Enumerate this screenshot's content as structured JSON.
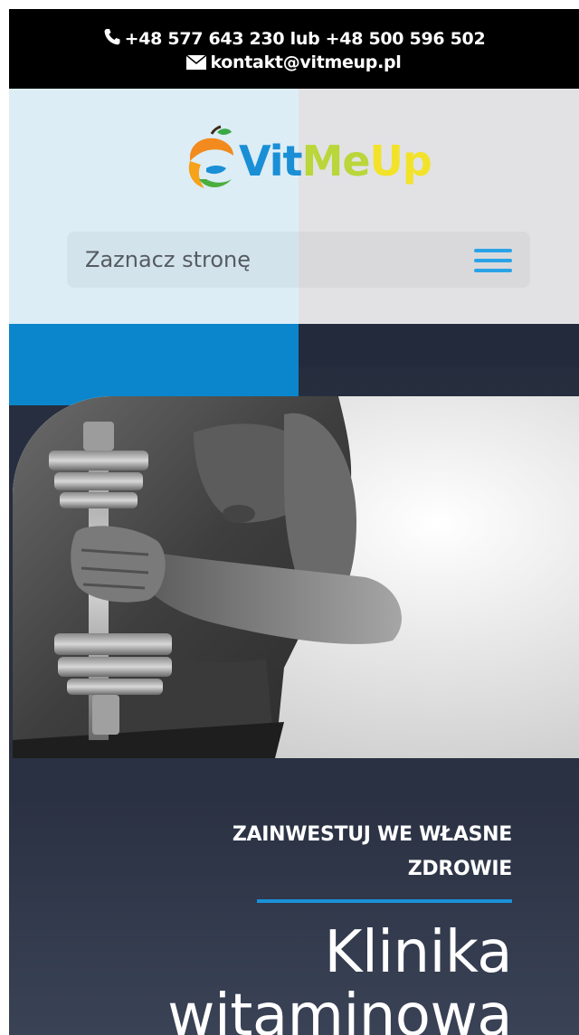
{
  "topbar": {
    "phone_icon": "phone-icon",
    "phone_text": "+48 577 643 230 lub +48 500 596 502",
    "email_icon": "envelope-icon",
    "email_text": "kontakt@vitmeup.pl"
  },
  "header": {
    "logo": {
      "part_vit": "Vit",
      "part_me": "Me",
      "part_up": "Up",
      "icon": "fruit-logo-icon"
    },
    "menu": {
      "label": "Zaznacz stronę",
      "icon": "hamburger-menu-icon"
    }
  },
  "hero": {
    "kicker_line1": "ZAINWESTUJ WE WŁASNE",
    "kicker_line2": "ZDROWIE",
    "title_line1": "Klinika",
    "title_line2": "witaminowa",
    "image": "muscular-man-dumbbell-photo"
  },
  "colors": {
    "topbar_bg": "#000000",
    "accent_blue": "#1a8fd6",
    "logo_green": "#b9d63a",
    "logo_yellow": "#f2e32a",
    "hero_bg": "#262d3e",
    "header_left_bg": "#dcedf6",
    "header_right_bg": "#e2e2e5"
  }
}
